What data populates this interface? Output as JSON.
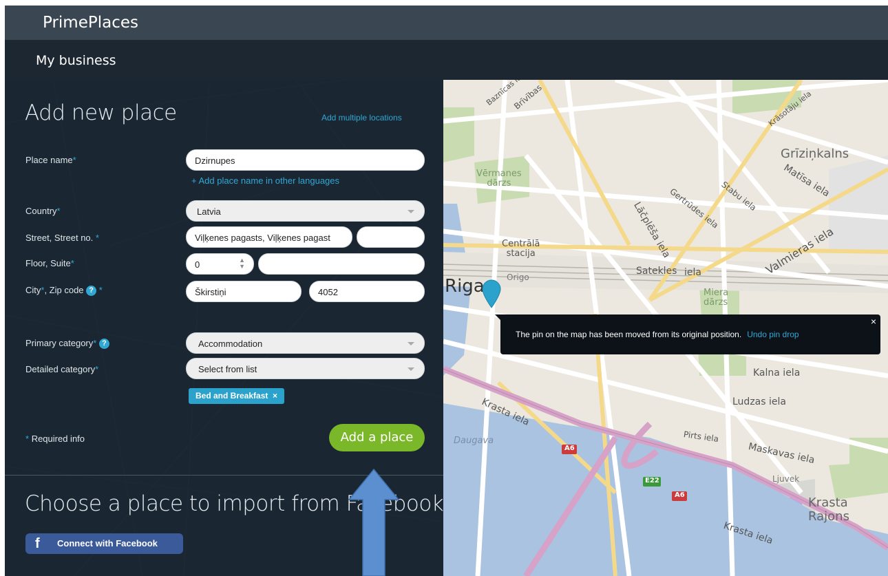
{
  "header": {
    "brand": "PrimePlaces",
    "nav": "My business"
  },
  "form": {
    "title": "Add new place",
    "add_multiple_link": "Add multiple locations",
    "place_name_label": "Place name",
    "place_name_value": "Dzirnupes",
    "add_lang_link": "+ Add place name in other languages",
    "country_label": "Country",
    "country_value": "Latvia",
    "street_label": "Street, Street no.",
    "street_value": "Viļķenes pagasts, Viļķenes pagast",
    "street_no_value": "",
    "floor_label": "Floor, Suite",
    "floor_value": "0",
    "suite_value": "",
    "city_label": "City",
    "zip_label": ", Zip code",
    "city_value": "Škirstiņi",
    "zip_value": "4052",
    "primary_category_label": "Primary category",
    "primary_category_value": "Accommodation",
    "detailed_category_label": "Detailed category",
    "detailed_category_value": "Select from list",
    "selected_tag": "Bed and Breakfast",
    "tag_remove": "×",
    "required_star": "*",
    "required_info": "Required info",
    "help_glyph": "?",
    "submit_label": "Add a place"
  },
  "facebook": {
    "title": "Choose a place to import from Facebook",
    "button_label": "Connect with Facebook",
    "button_icon": "f"
  },
  "map": {
    "tooltip_text": "The pin on the map has been moved from its original position.",
    "tooltip_undo": "Undo pin drop",
    "tooltip_close": "×",
    "labels": {
      "riga": "Riga",
      "grizinkalns": "Grīziņkalns",
      "satekles": "Satekles",
      "iela": "iela",
      "daugava": "Daugava",
      "krasta_rajons": "Krasta\nRajons",
      "krasta_iela": "Krasta iela",
      "krasta_iela2": "Krasta iela",
      "ludzas": "Ludzas iela",
      "kalna": "Kalna iela",
      "maskavas": "Maskavas iela",
      "pirts": "Pirts iela",
      "ljuvek": "Ljuvek",
      "centrala": "Centrālā\nstacija",
      "origo": "Origo",
      "vermanes": "Vērmanes\ndārzs",
      "miera": "Miera\ndārzs",
      "matisa": "Matīsa iela",
      "valmieras": "Valmieras iela",
      "stabu": "Stabu iela",
      "gertrudes": "Gertrūdes iela",
      "lacplesa": "Lāčplēša iela",
      "barona": "Baznīcas iela",
      "brivibas": "Brīvības",
      "krasotaju": "Krāsotāju iela",
      "route_a6": "A6",
      "route_e22": "E22",
      "route_a6b": "A6",
      "route_a6c": "A6"
    },
    "accent": "#2ba2cc",
    "submit_color": "#7ab82a"
  },
  "annotation": {
    "arrow_color": "#5b8fd0"
  }
}
